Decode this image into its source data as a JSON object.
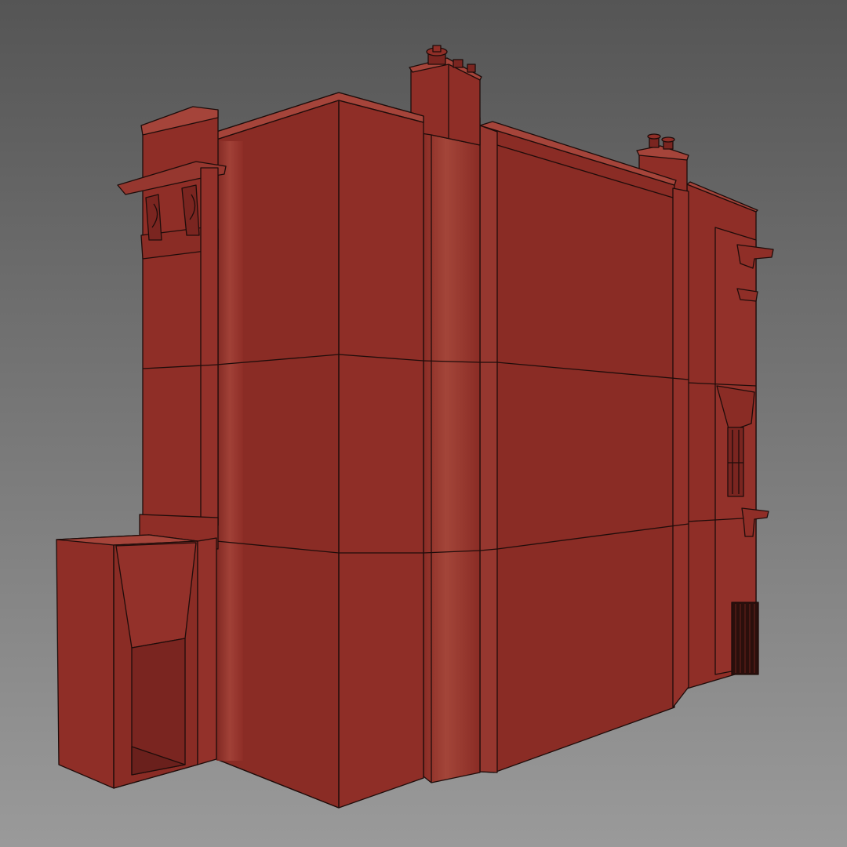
{
  "scene": {
    "background_top": "#555555",
    "background_bottom": "#9a9a9a",
    "model_color": "#8f2e27",
    "model_color_light": "#a5443a",
    "model_color_dark": "#7a2520",
    "edge_color": "#1e0c0a",
    "parts": [
      "left-annex",
      "left-pilaster-tower",
      "central-block",
      "vertical-pier",
      "chimney-stack-center",
      "right-wing",
      "chimney-stack-right",
      "far-right-wing",
      "small-window",
      "iron-gate"
    ]
  }
}
